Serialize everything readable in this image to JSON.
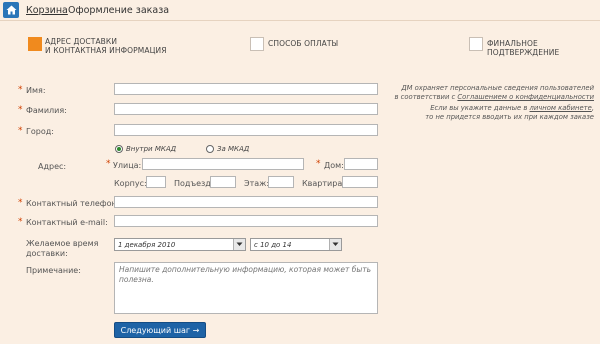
{
  "breadcrumb": {
    "home_icon": "home-icon",
    "cart": "Корзина",
    "current": "Оформление заказа"
  },
  "steps": [
    {
      "line1": "АДРЕС ДОСТАВКИ",
      "line2": "И КОНТАКТНАЯ ИНФОРМАЦИЯ",
      "active": true
    },
    {
      "line1": "СПОСОБ ОПЛАТЫ",
      "line2": "",
      "active": false
    },
    {
      "line1": "ФИНАЛЬНОЕ ПОДТВЕРЖДЕНИЕ",
      "line2": "",
      "active": false
    }
  ],
  "form": {
    "name_label": "Имя:",
    "surname_label": "Фамилия:",
    "city_label": "Город:",
    "mkad_inside": "Внутри МКАД",
    "mkad_outside": "За МКАД",
    "address_label": "Адрес:",
    "street_label": "Улица:",
    "house_label": "Дом:",
    "building_label": "Корпус:",
    "entrance_label": "Подъезд:",
    "floor_label": "Этаж:",
    "apartment_label": "Квартира:",
    "phone_label": "Контактный телефон:",
    "email_label": "Контактный e-mail:",
    "time_label_1": "Желаемое время",
    "time_label_2": "доставки:",
    "date_value": "1 декабря 2010",
    "time_value": "с 10 до 14",
    "comment_label": "Примечание:",
    "comment_placeholder": "Напишите дополнительную информацию, которая может быть полезна.",
    "required_mark": "*"
  },
  "notes": {
    "privacy_1": "ДМ охраняет персональные сведения пользователей",
    "privacy_2a": "в соответствии с ",
    "privacy_2b": "Соглашением о конфиденциальности",
    "cabinet_1a": "Если вы укажите данные в ",
    "cabinet_1b": "личном кабинете",
    "cabinet_1c": ",",
    "cabinet_2": "то не придется вводить их при каждом заказе"
  },
  "next_button": "Следующий шаг →",
  "colors": {
    "accent_orange": "#f08a1e",
    "brand_blue": "#1e63a6",
    "background": "#fbefe3"
  }
}
